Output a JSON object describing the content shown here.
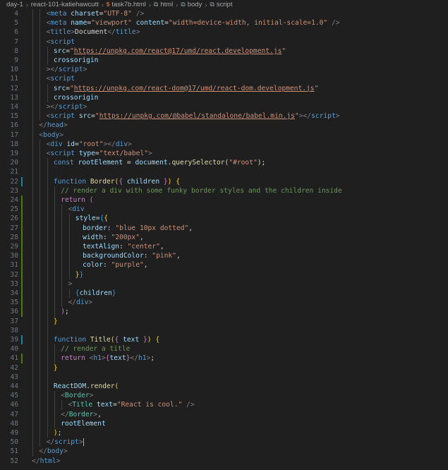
{
  "breadcrumb": {
    "items": [
      {
        "label": "day-1",
        "icon": ""
      },
      {
        "label": "react-101-katiehawcutt",
        "icon": ""
      },
      {
        "label": "task7b.html",
        "icon": "html5-file-icon"
      },
      {
        "label": "html",
        "icon": "element-icon"
      },
      {
        "label": "body",
        "icon": "element-icon"
      },
      {
        "label": "script",
        "icon": "element-icon"
      }
    ]
  },
  "editor": {
    "lines": [
      {
        "n": "4",
        "indent": 2,
        "mod": "",
        "tokens": [
          [
            "br",
            "<"
          ],
          [
            "tag",
            "meta"
          ],
          [
            "sp",
            " "
          ],
          [
            "attr",
            "charset"
          ],
          [
            "plain",
            "="
          ],
          [
            "str",
            "\"UTF-8\""
          ],
          [
            "sp",
            " "
          ],
          [
            "br",
            "/>"
          ]
        ]
      },
      {
        "n": "5",
        "indent": 2,
        "mod": "",
        "tokens": [
          [
            "br",
            "<"
          ],
          [
            "tag",
            "meta"
          ],
          [
            "sp",
            " "
          ],
          [
            "attr",
            "name"
          ],
          [
            "plain",
            "="
          ],
          [
            "str",
            "\"viewport\""
          ],
          [
            "sp",
            " "
          ],
          [
            "attr",
            "content"
          ],
          [
            "plain",
            "="
          ],
          [
            "str",
            "\"width=device-width, initial-scale=1.0\""
          ],
          [
            "sp",
            " "
          ],
          [
            "br",
            "/>"
          ]
        ]
      },
      {
        "n": "6",
        "indent": 2,
        "mod": "",
        "tokens": [
          [
            "br",
            "<"
          ],
          [
            "tag",
            "title"
          ],
          [
            "br",
            ">"
          ],
          [
            "plain",
            "Document"
          ],
          [
            "br",
            "</"
          ],
          [
            "tag",
            "title"
          ],
          [
            "br",
            ">"
          ]
        ]
      },
      {
        "n": "7",
        "indent": 2,
        "mod": "",
        "tokens": [
          [
            "br",
            "<"
          ],
          [
            "tag",
            "script"
          ]
        ]
      },
      {
        "n": "8",
        "indent": 3,
        "mod": "",
        "tokens": [
          [
            "attr",
            "src"
          ],
          [
            "plain",
            "="
          ],
          [
            "str",
            "\""
          ],
          [
            "url",
            "https://unpkg.com/react@17/umd/react.development.js"
          ],
          [
            "str",
            "\""
          ]
        ]
      },
      {
        "n": "9",
        "indent": 3,
        "mod": "",
        "tokens": [
          [
            "attr",
            "crossorigin"
          ]
        ]
      },
      {
        "n": "10",
        "indent": 2,
        "mod": "",
        "tokens": [
          [
            "br",
            "></"
          ],
          [
            "tag",
            "script"
          ],
          [
            "br",
            ">"
          ]
        ]
      },
      {
        "n": "11",
        "indent": 2,
        "mod": "",
        "tokens": [
          [
            "br",
            "<"
          ],
          [
            "tag",
            "script"
          ]
        ]
      },
      {
        "n": "12",
        "indent": 3,
        "mod": "",
        "tokens": [
          [
            "attr",
            "src"
          ],
          [
            "plain",
            "="
          ],
          [
            "str",
            "\""
          ],
          [
            "url",
            "https://unpkg.com/react-dom@17/umd/react-dom.development.js"
          ],
          [
            "str",
            "\""
          ]
        ]
      },
      {
        "n": "13",
        "indent": 3,
        "mod": "",
        "tokens": [
          [
            "attr",
            "crossorigin"
          ]
        ]
      },
      {
        "n": "14",
        "indent": 2,
        "mod": "",
        "tokens": [
          [
            "br",
            "></"
          ],
          [
            "tag",
            "script"
          ],
          [
            "br",
            ">"
          ]
        ]
      },
      {
        "n": "15",
        "indent": 2,
        "mod": "",
        "tokens": [
          [
            "br",
            "<"
          ],
          [
            "tag",
            "script"
          ],
          [
            "sp",
            " "
          ],
          [
            "attr",
            "src"
          ],
          [
            "plain",
            "="
          ],
          [
            "str",
            "\""
          ],
          [
            "url",
            "https://unpkg.com/@babel/standalone/babel.min.js"
          ],
          [
            "str",
            "\""
          ],
          [
            "br",
            "></"
          ],
          [
            "tag",
            "script"
          ],
          [
            "br",
            ">"
          ]
        ]
      },
      {
        "n": "16",
        "indent": 1,
        "mod": "",
        "tokens": [
          [
            "br",
            "</"
          ],
          [
            "tag",
            "head"
          ],
          [
            "br",
            ">"
          ]
        ]
      },
      {
        "n": "17",
        "indent": 1,
        "mod": "",
        "tokens": [
          [
            "br",
            "<"
          ],
          [
            "tag",
            "body"
          ],
          [
            "br",
            ">"
          ]
        ]
      },
      {
        "n": "18",
        "indent": 2,
        "mod": "",
        "tokens": [
          [
            "br",
            "<"
          ],
          [
            "tag",
            "div"
          ],
          [
            "sp",
            " "
          ],
          [
            "attr",
            "id"
          ],
          [
            "plain",
            "="
          ],
          [
            "str",
            "\"root\""
          ],
          [
            "br",
            "></"
          ],
          [
            "tag",
            "div"
          ],
          [
            "br",
            ">"
          ]
        ]
      },
      {
        "n": "19",
        "indent": 2,
        "mod": "",
        "tokens": [
          [
            "br",
            "<"
          ],
          [
            "tag",
            "script"
          ],
          [
            "sp",
            " "
          ],
          [
            "attr",
            "type"
          ],
          [
            "plain",
            "="
          ],
          [
            "str",
            "\"text/babel\""
          ],
          [
            "br",
            ">"
          ]
        ]
      },
      {
        "n": "20",
        "indent": 3,
        "mod": "",
        "tokens": [
          [
            "decl",
            "const"
          ],
          [
            "sp",
            " "
          ],
          [
            "var",
            "rootElement"
          ],
          [
            "plain",
            " = "
          ],
          [
            "var",
            "document"
          ],
          [
            "plain",
            "."
          ],
          [
            "fn",
            "querySelector"
          ],
          [
            "plain",
            "("
          ],
          [
            "str",
            "\"#root\""
          ],
          [
            "plain",
            ");"
          ]
        ]
      },
      {
        "n": "21",
        "indent": 0,
        "mod": "",
        "tokens": []
      },
      {
        "n": "22",
        "indent": 3,
        "mod": "blue",
        "tokens": [
          [
            "decl",
            "function"
          ],
          [
            "sp",
            " "
          ],
          [
            "fn",
            "Border"
          ],
          [
            "brace",
            "("
          ],
          [
            "brace2",
            "{"
          ],
          [
            "sp",
            " "
          ],
          [
            "var",
            "children"
          ],
          [
            "sp",
            " "
          ],
          [
            "brace2",
            "}"
          ],
          [
            "brace",
            ")"
          ],
          [
            "sp",
            " "
          ],
          [
            "brace",
            "{"
          ]
        ]
      },
      {
        "n": "23",
        "indent": 4,
        "mod": "",
        "tokens": [
          [
            "cmt",
            "// render a div with some funky border styles and the children inside"
          ]
        ]
      },
      {
        "n": "24",
        "indent": 4,
        "mod": "green",
        "tokens": [
          [
            "ctrl",
            "return"
          ],
          [
            "sp",
            " "
          ],
          [
            "brace2",
            "("
          ]
        ]
      },
      {
        "n": "25",
        "indent": 5,
        "mod": "green",
        "tokens": [
          [
            "br",
            "<"
          ],
          [
            "tag",
            "div"
          ]
        ]
      },
      {
        "n": "26",
        "indent": 6,
        "mod": "green",
        "tokens": [
          [
            "attr",
            "style"
          ],
          [
            "plain",
            "="
          ],
          [
            "brace3",
            "{"
          ],
          [
            "brace",
            "{"
          ]
        ]
      },
      {
        "n": "27",
        "indent": 7,
        "mod": "green",
        "tokens": [
          [
            "var",
            "border"
          ],
          [
            "plain",
            ": "
          ],
          [
            "str",
            "\"blue 10px dotted\""
          ],
          [
            "plain",
            ","
          ]
        ]
      },
      {
        "n": "28",
        "indent": 7,
        "mod": "green",
        "tokens": [
          [
            "var",
            "width"
          ],
          [
            "plain",
            ": "
          ],
          [
            "str",
            "\"200px\""
          ],
          [
            "plain",
            ","
          ]
        ]
      },
      {
        "n": "29",
        "indent": 7,
        "mod": "green",
        "tokens": [
          [
            "var",
            "textAlign"
          ],
          [
            "plain",
            ": "
          ],
          [
            "str",
            "\"center\""
          ],
          [
            "plain",
            ","
          ]
        ]
      },
      {
        "n": "30",
        "indent": 7,
        "mod": "green",
        "tokens": [
          [
            "var",
            "backgroundColor"
          ],
          [
            "plain",
            ": "
          ],
          [
            "str",
            "\"pink\""
          ],
          [
            "plain",
            ","
          ]
        ]
      },
      {
        "n": "31",
        "indent": 7,
        "mod": "green",
        "tokens": [
          [
            "var",
            "color"
          ],
          [
            "plain",
            ": "
          ],
          [
            "str",
            "\"purple\""
          ],
          [
            "plain",
            ","
          ]
        ]
      },
      {
        "n": "32",
        "indent": 6,
        "mod": "green",
        "tokens": [
          [
            "brace",
            "}"
          ],
          [
            "brace3",
            "}"
          ]
        ]
      },
      {
        "n": "33",
        "indent": 5,
        "mod": "green",
        "tokens": [
          [
            "br",
            ">"
          ]
        ]
      },
      {
        "n": "34",
        "indent": 6,
        "mod": "green",
        "tokens": [
          [
            "brace3",
            "{"
          ],
          [
            "var",
            "children"
          ],
          [
            "brace3",
            "}"
          ]
        ]
      },
      {
        "n": "35",
        "indent": 5,
        "mod": "green",
        "tokens": [
          [
            "br",
            "</"
          ],
          [
            "tag",
            "div"
          ],
          [
            "br",
            ">"
          ]
        ]
      },
      {
        "n": "36",
        "indent": 4,
        "mod": "green",
        "tokens": [
          [
            "brace2",
            ")"
          ],
          [
            "plain",
            ";"
          ]
        ]
      },
      {
        "n": "37",
        "indent": 3,
        "mod": "",
        "tokens": [
          [
            "brace",
            "}"
          ]
        ]
      },
      {
        "n": "38",
        "indent": 0,
        "mod": "",
        "tokens": []
      },
      {
        "n": "39",
        "indent": 3,
        "mod": "blue",
        "tokens": [
          [
            "decl",
            "function"
          ],
          [
            "sp",
            " "
          ],
          [
            "fn",
            "Title"
          ],
          [
            "brace",
            "("
          ],
          [
            "brace2",
            "{"
          ],
          [
            "sp",
            " "
          ],
          [
            "var",
            "text"
          ],
          [
            "sp",
            " "
          ],
          [
            "brace2",
            "}"
          ],
          [
            "brace",
            ")"
          ],
          [
            "sp",
            " "
          ],
          [
            "brace",
            "{"
          ]
        ]
      },
      {
        "n": "40",
        "indent": 4,
        "mod": "",
        "tokens": [
          [
            "cmt",
            "// render a title"
          ]
        ]
      },
      {
        "n": "41",
        "indent": 4,
        "mod": "green",
        "tokens": [
          [
            "ctrl",
            "return"
          ],
          [
            "sp",
            " "
          ],
          [
            "br",
            "<"
          ],
          [
            "tag",
            "h1"
          ],
          [
            "br",
            ">"
          ],
          [
            "brace2",
            "{"
          ],
          [
            "var",
            "text"
          ],
          [
            "brace2",
            "}"
          ],
          [
            "br",
            "</"
          ],
          [
            "tag",
            "h1"
          ],
          [
            "br",
            ">"
          ],
          [
            "plain",
            ";"
          ]
        ]
      },
      {
        "n": "42",
        "indent": 3,
        "mod": "",
        "tokens": [
          [
            "brace",
            "}"
          ]
        ]
      },
      {
        "n": "43",
        "indent": 0,
        "mod": "",
        "tokens": []
      },
      {
        "n": "44",
        "indent": 3,
        "mod": "",
        "tokens": [
          [
            "var",
            "ReactDOM"
          ],
          [
            "plain",
            "."
          ],
          [
            "fn",
            "render"
          ],
          [
            "brace",
            "("
          ]
        ]
      },
      {
        "n": "45",
        "indent": 4,
        "mod": "",
        "tokens": [
          [
            "br",
            "<"
          ],
          [
            "comp",
            "Border"
          ],
          [
            "br",
            ">"
          ]
        ]
      },
      {
        "n": "46",
        "indent": 5,
        "mod": "",
        "tokens": [
          [
            "br",
            "<"
          ],
          [
            "comp",
            "Title"
          ],
          [
            "sp",
            " "
          ],
          [
            "attr",
            "text"
          ],
          [
            "plain",
            "="
          ],
          [
            "str",
            "\"React is cool.\""
          ],
          [
            "sp",
            " "
          ],
          [
            "br",
            "/>"
          ]
        ]
      },
      {
        "n": "47",
        "indent": 4,
        "mod": "",
        "tokens": [
          [
            "br",
            "</"
          ],
          [
            "comp",
            "Border"
          ],
          [
            "br",
            ">"
          ],
          [
            "plain",
            ","
          ]
        ]
      },
      {
        "n": "48",
        "indent": 4,
        "mod": "",
        "tokens": [
          [
            "var",
            "rootElement"
          ]
        ]
      },
      {
        "n": "49",
        "indent": 3,
        "mod": "",
        "tokens": [
          [
            "brace",
            ")"
          ],
          [
            "plain",
            ";"
          ]
        ]
      },
      {
        "n": "50",
        "indent": 2,
        "mod": "",
        "cursor": true,
        "tokens": [
          [
            "br",
            "</"
          ],
          [
            "tag",
            "script"
          ],
          [
            "br",
            ">"
          ]
        ]
      },
      {
        "n": "51",
        "indent": 1,
        "mod": "",
        "tokens": [
          [
            "br",
            "</"
          ],
          [
            "tag",
            "body"
          ],
          [
            "br",
            ">"
          ]
        ]
      },
      {
        "n": "52",
        "indent": 0,
        "mod": "",
        "tokens": [
          [
            "br",
            "</"
          ],
          [
            "tag",
            "html"
          ],
          [
            "br",
            ">"
          ]
        ]
      }
    ]
  },
  "colors": {
    "background": "#1f1f1f",
    "modified_blue": "#1b81a8",
    "modified_green": "#487e02"
  }
}
